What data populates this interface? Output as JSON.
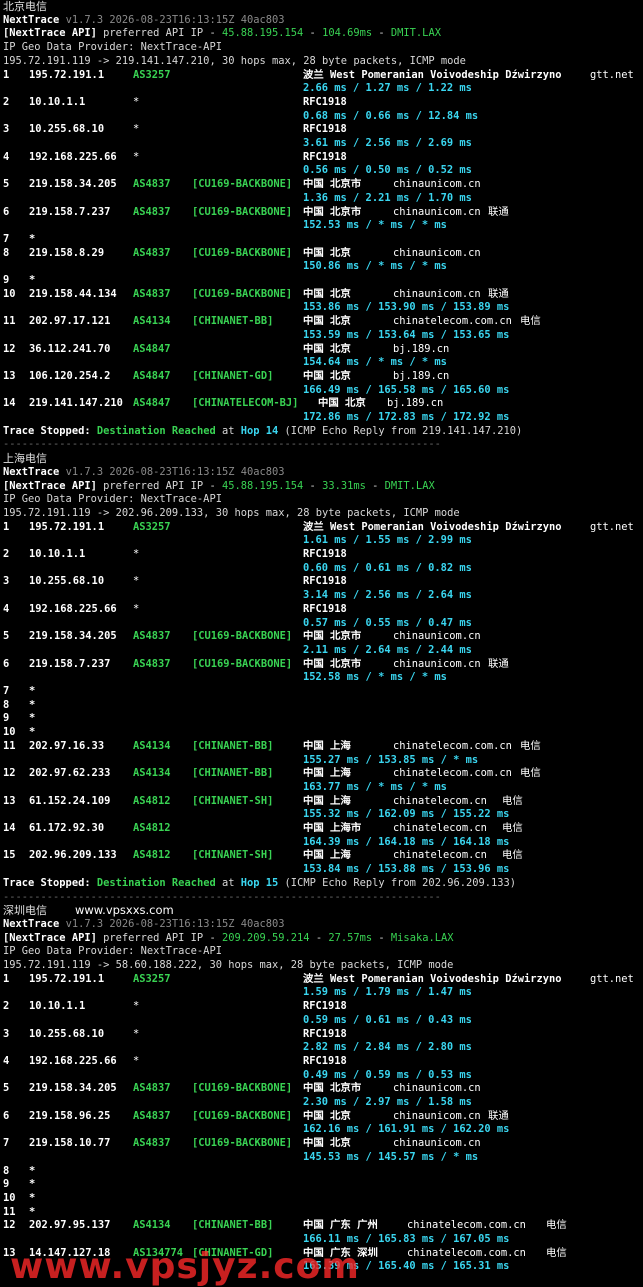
{
  "sections": [
    {
      "title": "北京电信",
      "site": "",
      "version_name": "NextTrace",
      "version_info": "v1.7.3 2026-08-23T16:13:15Z 40ac803",
      "api_prefix": "[NextTrace API]",
      "api_mid": " preferred API IP - ",
      "api_ip": "45.88.195.154",
      "api_dash1": " - ",
      "api_latency": "104.69ms",
      "api_dash2": " - ",
      "api_node": "DMIT.LAX",
      "geo": "IP Geo Data Provider: NextTrace-API",
      "route": "195.72.191.119 -> 219.141.147.210, 30 hops max, 28 byte packets, ICMP mode",
      "hops": [
        {
          "n": "1",
          "ip": "195.72.191.1",
          "as": "AS3257",
          "tag": "",
          "geo": "波兰 West Pomeranian Voivodeship Dźwirzyno",
          "domain": "gtt.net",
          "isp": "",
          "rtt": "2.66 ms / 1.27 ms / 1.22 ms"
        },
        {
          "n": "2",
          "ip": "10.10.1.1",
          "as": "*",
          "tag": "",
          "geo": "RFC1918",
          "domain": "",
          "isp": "",
          "rtt": "0.68 ms / 0.66 ms / 12.84 ms"
        },
        {
          "n": "3",
          "ip": "10.255.68.10",
          "as": "*",
          "tag": "",
          "geo": "RFC1918",
          "domain": "",
          "isp": "",
          "rtt": "3.61 ms / 2.56 ms / 2.69 ms"
        },
        {
          "n": "4",
          "ip": "192.168.225.66",
          "as": "*",
          "tag": "",
          "geo": "RFC1918",
          "domain": "",
          "isp": "",
          "rtt": "0.56 ms / 0.50 ms / 0.52 ms"
        },
        {
          "n": "5",
          "ip": "219.158.34.205",
          "as": "AS4837",
          "tag": "[CU169-BACKBONE]",
          "geo": "中国 北京市",
          "domain": "chinaunicom.cn",
          "isp": "",
          "rtt": "1.36 ms / 2.21 ms / 1.70 ms"
        },
        {
          "n": "6",
          "ip": "219.158.7.237",
          "as": "AS4837",
          "tag": "[CU169-BACKBONE]",
          "geo": "中国 北京市",
          "domain": "chinaunicom.cn",
          "isp": "联通",
          "rtt": "152.53 ms / * ms / * ms"
        },
        {
          "n": "7",
          "star": "*"
        },
        {
          "n": "8",
          "ip": "219.158.8.29",
          "as": "AS4837",
          "tag": "[CU169-BACKBONE]",
          "geo": "中国 北京",
          "domain": "chinaunicom.cn",
          "isp": "",
          "rtt": "150.86 ms / * ms / * ms"
        },
        {
          "n": "9",
          "star": "*"
        },
        {
          "n": "10",
          "ip": "219.158.44.134",
          "as": "AS4837",
          "tag": "[CU169-BACKBONE]",
          "geo": "中国 北京",
          "domain": "chinaunicom.cn",
          "isp": "联通",
          "rtt": "153.86 ms / 153.90 ms / 153.89 ms"
        },
        {
          "n": "11",
          "ip": "202.97.17.121",
          "as": "AS4134",
          "tag": "[CHINANET-BB]",
          "geo": "中国 北京",
          "domain": "chinatelecom.com.cn",
          "isp": "电信",
          "rtt": "153.59 ms / 153.64 ms / 153.65 ms"
        },
        {
          "n": "12",
          "ip": "36.112.241.70",
          "as": "AS4847",
          "tag": "",
          "geo": "中国 北京",
          "domain": "bj.189.cn",
          "isp": "",
          "rtt": "154.64 ms / * ms / * ms"
        },
        {
          "n": "13",
          "ip": "106.120.254.2",
          "as": "AS4847",
          "tag": "[CHINANET-GD]",
          "geo": "中国 北京",
          "domain": "bj.189.cn",
          "isp": "",
          "rtt": "166.49 ms / 165.58 ms / 165.60 ms"
        },
        {
          "n": "14",
          "ip": "219.141.147.210",
          "as": "AS4847",
          "tag": "[CHINATELECOM-BJ]",
          "geo": "中国 北京",
          "domain": "bj.189.cn",
          "isp": "",
          "rtt": "172.86 ms / 172.83 ms / 172.92 ms"
        }
      ],
      "stop_label": "Trace Stopped:",
      "stop_reached": "Destination Reached",
      "stop_at": " at ",
      "stop_hop": "Hop 14",
      "stop_tail": " (ICMP Echo Reply from 219.141.147.210)"
    },
    {
      "title": "上海电信",
      "site": "",
      "version_name": "NextTrace",
      "version_info": "v1.7.3 2026-08-23T16:13:15Z 40ac803",
      "api_prefix": "[NextTrace API]",
      "api_mid": " preferred API IP - ",
      "api_ip": "45.88.195.154",
      "api_dash1": " - ",
      "api_latency": "33.31ms",
      "api_dash2": " - ",
      "api_node": "DMIT.LAX",
      "geo": "IP Geo Data Provider: NextTrace-API",
      "route": "195.72.191.119 -> 202.96.209.133, 30 hops max, 28 byte packets, ICMP mode",
      "hops": [
        {
          "n": "1",
          "ip": "195.72.191.1",
          "as": "AS3257",
          "tag": "",
          "geo": "波兰 West Pomeranian Voivodeship Dźwirzyno",
          "domain": "gtt.net",
          "isp": "",
          "rtt": "1.61 ms / 1.55 ms / 2.99 ms"
        },
        {
          "n": "2",
          "ip": "10.10.1.1",
          "as": "*",
          "tag": "",
          "geo": "RFC1918",
          "domain": "",
          "isp": "",
          "rtt": "0.60 ms / 0.61 ms / 0.82 ms"
        },
        {
          "n": "3",
          "ip": "10.255.68.10",
          "as": "*",
          "tag": "",
          "geo": "RFC1918",
          "domain": "",
          "isp": "",
          "rtt": "3.14 ms / 2.56 ms / 2.64 ms"
        },
        {
          "n": "4",
          "ip": "192.168.225.66",
          "as": "*",
          "tag": "",
          "geo": "RFC1918",
          "domain": "",
          "isp": "",
          "rtt": "0.57 ms / 0.55 ms / 0.47 ms"
        },
        {
          "n": "5",
          "ip": "219.158.34.205",
          "as": "AS4837",
          "tag": "[CU169-BACKBONE]",
          "geo": "中国 北京市",
          "domain": "chinaunicom.cn",
          "isp": "",
          "rtt": "2.11 ms / 2.64 ms / 2.44 ms"
        },
        {
          "n": "6",
          "ip": "219.158.7.237",
          "as": "AS4837",
          "tag": "[CU169-BACKBONE]",
          "geo": "中国 北京市",
          "domain": "chinaunicom.cn",
          "isp": "联通",
          "rtt": "152.58 ms / * ms / * ms"
        },
        {
          "n": "7",
          "star": "*"
        },
        {
          "n": "8",
          "star": "*"
        },
        {
          "n": "9",
          "star": "*"
        },
        {
          "n": "10",
          "star": "*"
        },
        {
          "n": "11",
          "ip": "202.97.16.33",
          "as": "AS4134",
          "tag": "[CHINANET-BB]",
          "geo": "中国 上海",
          "domain": "chinatelecom.com.cn",
          "isp": "电信",
          "rtt": "155.27 ms / 153.85 ms / * ms"
        },
        {
          "n": "12",
          "ip": "202.97.62.233",
          "as": "AS4134",
          "tag": "[CHINANET-BB]",
          "geo": "中国 上海",
          "domain": "chinatelecom.com.cn",
          "isp": "电信",
          "rtt": "163.77 ms / * ms / * ms"
        },
        {
          "n": "13",
          "ip": "61.152.24.109",
          "as": "AS4812",
          "tag": "[CHINANET-SH]",
          "geo": "中国 上海",
          "domain": "chinatelecom.cn",
          "isp": "电信",
          "rtt": "155.32 ms / 162.09 ms / 155.22 ms"
        },
        {
          "n": "14",
          "ip": "61.172.92.30",
          "as": "AS4812",
          "tag": "",
          "geo": "中国 上海市",
          "domain": "chinatelecom.cn",
          "isp": "电信",
          "rtt": "164.39 ms / 164.18 ms / 164.18 ms"
        },
        {
          "n": "15",
          "ip": "202.96.209.133",
          "as": "AS4812",
          "tag": "[CHINANET-SH]",
          "geo": "中国 上海",
          "domain": "chinatelecom.cn",
          "isp": "电信",
          "rtt": "153.84 ms / 153.88 ms / 153.96 ms"
        }
      ],
      "stop_label": "Trace Stopped:",
      "stop_reached": "Destination Reached",
      "stop_at": " at ",
      "stop_hop": "Hop 15",
      "stop_tail": " (ICMP Echo Reply from 202.96.209.133)"
    },
    {
      "title": "深圳电信",
      "site": "www.vpsxxs.com",
      "version_name": "NextTrace",
      "version_info": "v1.7.3 2026-08-23T16:13:15Z 40ac803",
      "api_prefix": "[NextTrace API]",
      "api_mid": " preferred API IP - ",
      "api_ip": "209.209.59.214",
      "api_dash1": " - ",
      "api_latency": "27.57ms",
      "api_dash2": " - ",
      "api_node": "Misaka.LAX",
      "geo": "IP Geo Data Provider: NextTrace-API",
      "route": "195.72.191.119 -> 58.60.188.222, 30 hops max, 28 byte packets, ICMP mode",
      "hops": [
        {
          "n": "1",
          "ip": "195.72.191.1",
          "as": "AS3257",
          "tag": "",
          "geo": "波兰 West Pomeranian Voivodeship Dźwirzyno",
          "domain": "gtt.net",
          "isp": "",
          "rtt": "1.59 ms / 1.79 ms / 1.47 ms"
        },
        {
          "n": "2",
          "ip": "10.10.1.1",
          "as": "*",
          "tag": "",
          "geo": "RFC1918",
          "domain": "",
          "isp": "",
          "rtt": "0.59 ms / 0.61 ms / 0.43 ms"
        },
        {
          "n": "3",
          "ip": "10.255.68.10",
          "as": "*",
          "tag": "",
          "geo": "RFC1918",
          "domain": "",
          "isp": "",
          "rtt": "2.82 ms / 2.84 ms / 2.80 ms"
        },
        {
          "n": "4",
          "ip": "192.168.225.66",
          "as": "*",
          "tag": "",
          "geo": "RFC1918",
          "domain": "",
          "isp": "",
          "rtt": "0.49 ms / 0.59 ms / 0.53 ms"
        },
        {
          "n": "5",
          "ip": "219.158.34.205",
          "as": "AS4837",
          "tag": "[CU169-BACKBONE]",
          "geo": "中国 北京市",
          "domain": "chinaunicom.cn",
          "isp": "",
          "rtt": "2.30 ms / 2.97 ms / 1.58 ms"
        },
        {
          "n": "6",
          "ip": "219.158.96.25",
          "as": "AS4837",
          "tag": "[CU169-BACKBONE]",
          "geo": "中国 北京",
          "domain": "chinaunicom.cn",
          "isp": "联通",
          "rtt": "162.16 ms / 161.91 ms / 162.20 ms"
        },
        {
          "n": "7",
          "ip": "219.158.10.77",
          "as": "AS4837",
          "tag": "[CU169-BACKBONE]",
          "geo": "中国 北京",
          "domain": "chinaunicom.cn",
          "isp": "",
          "rtt": "145.53 ms / 145.57 ms / * ms"
        },
        {
          "n": "8",
          "star": "*"
        },
        {
          "n": "9",
          "star": "*"
        },
        {
          "n": "10",
          "star": "*"
        },
        {
          "n": "11",
          "star": "*"
        },
        {
          "n": "12",
          "ip": "202.97.95.137",
          "as": "AS4134",
          "tag": "[CHINANET-BB]",
          "geo": "中国 广东 广州",
          "domain": "chinatelecom.com.cn",
          "isp": "电信",
          "rtt": "166.11 ms / 165.83 ms / 167.05 ms"
        },
        {
          "n": "13",
          "ip": "14.147.127.18",
          "as": "AS134774",
          "tag": "[CHINANET-GD]",
          "geo": "中国 广东 深圳",
          "domain": "chinatelecom.com.cn",
          "isp": "电信",
          "rtt": "165.39 ms / 165.40 ms / 165.31 ms"
        }
      ]
    }
  ],
  "separator": "----------------------------------------------------------------------",
  "watermark": "www.vpsjyz.com"
}
